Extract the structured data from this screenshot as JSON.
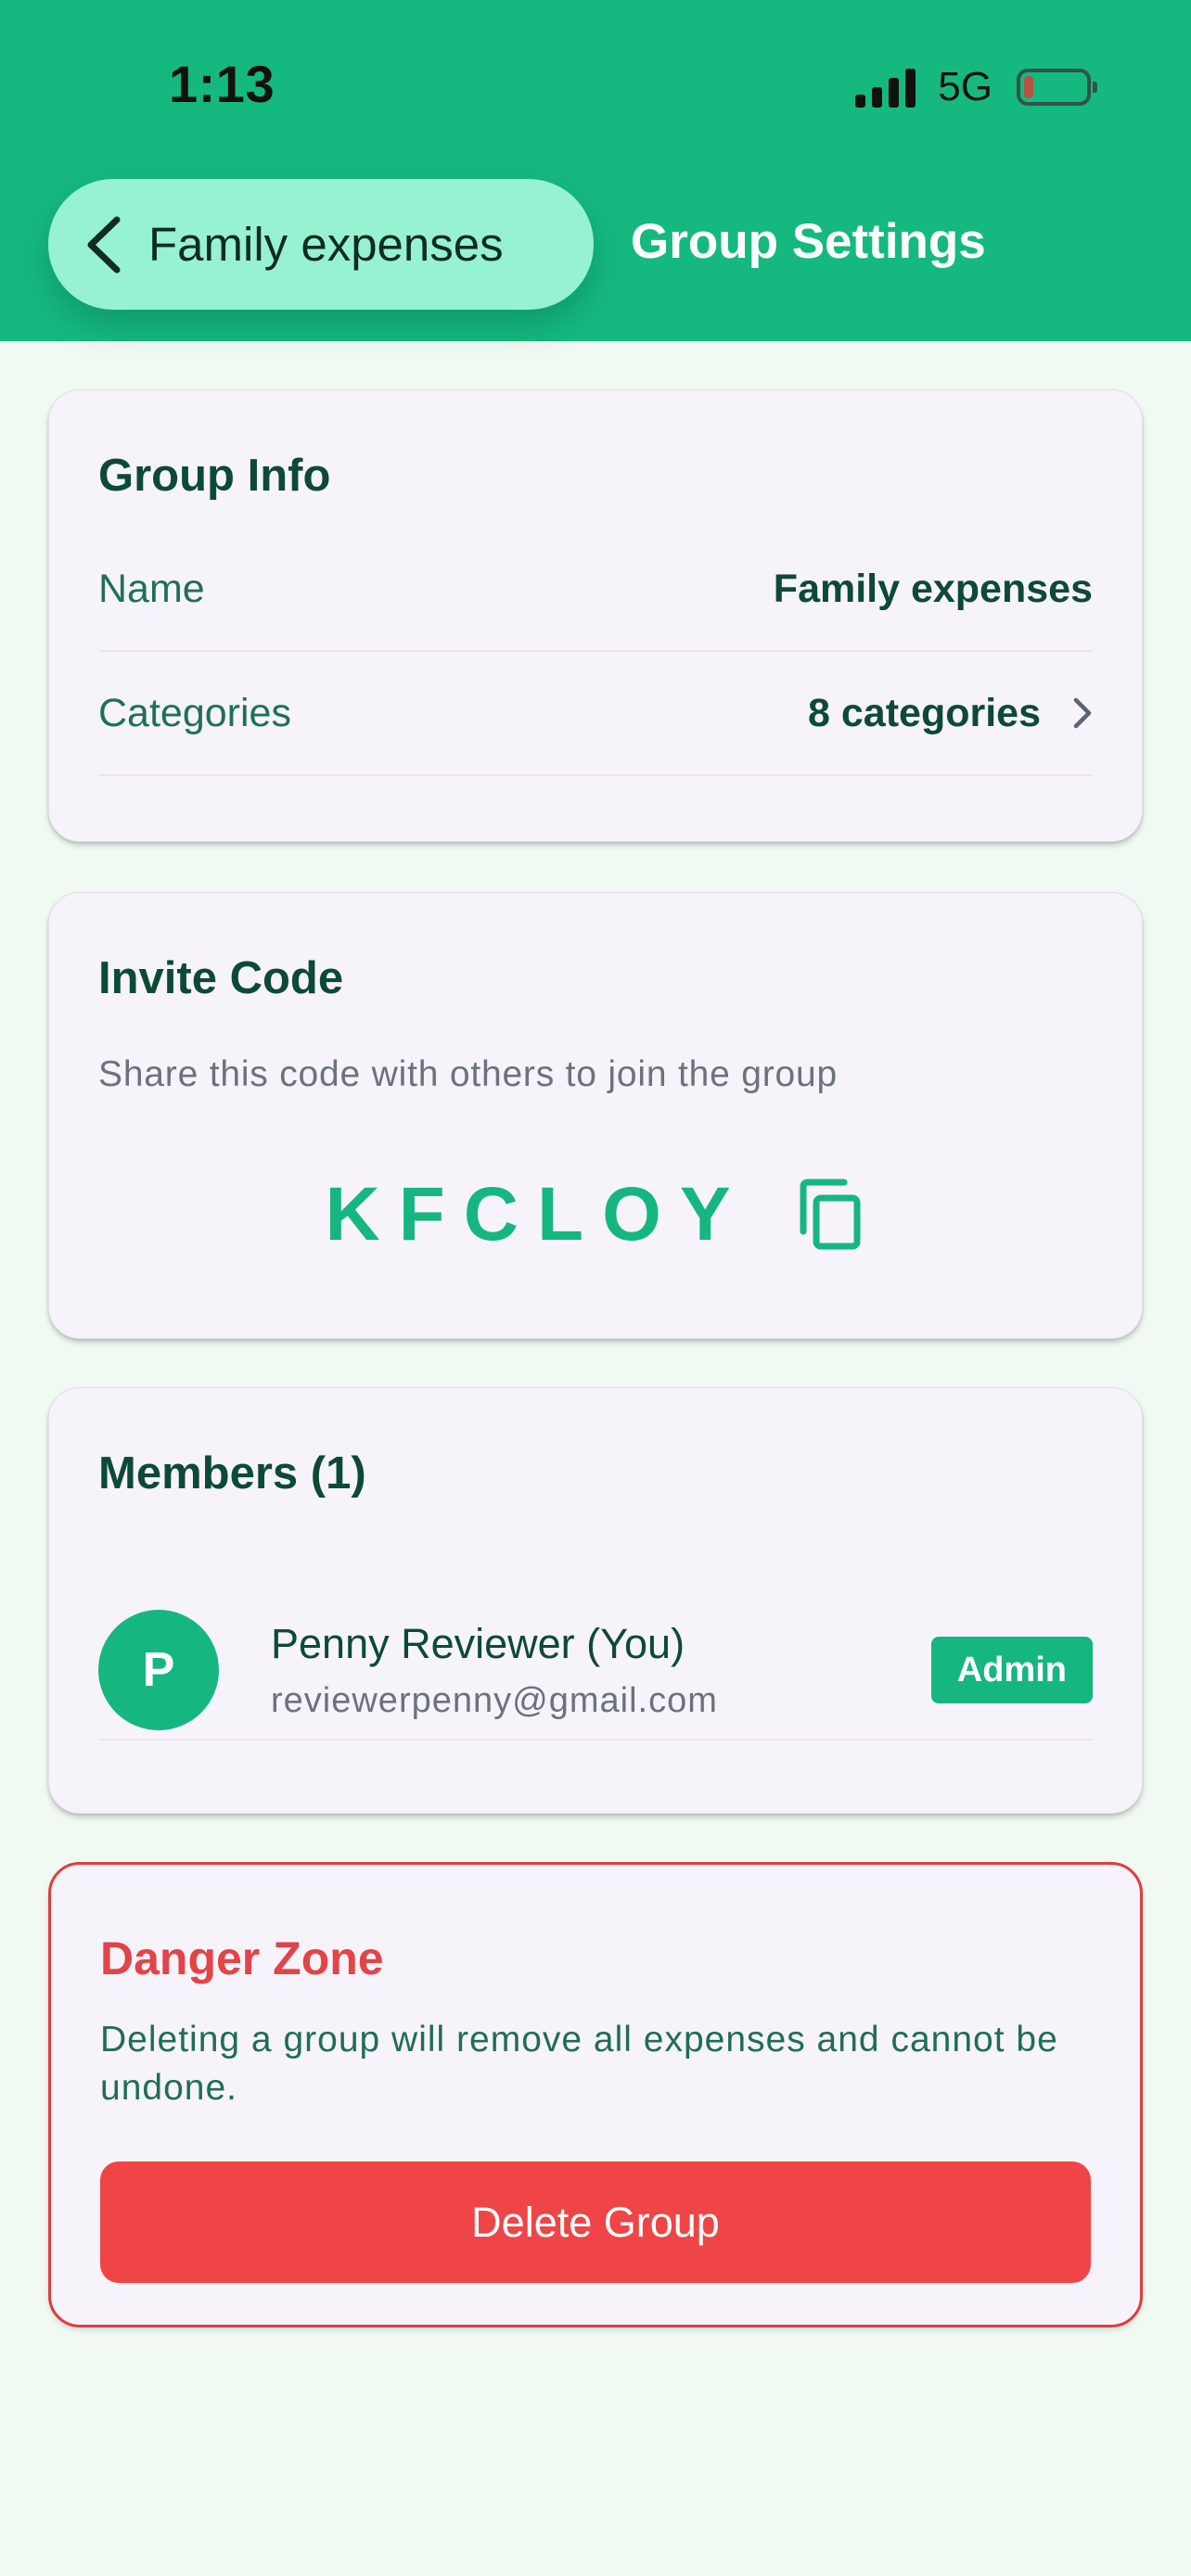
{
  "status_bar": {
    "time": "1:13",
    "network": "5G"
  },
  "header": {
    "back_label": "Family expenses",
    "title": "Group Settings"
  },
  "group_info": {
    "title": "Group Info",
    "name_label": "Name",
    "name_value": "Family expenses",
    "categories_label": "Categories",
    "categories_value": "8 categories"
  },
  "invite": {
    "title": "Invite Code",
    "description": "Share this code with others to join the group",
    "code": "KFCLOY"
  },
  "members": {
    "title": "Members (1)",
    "list": [
      {
        "initial": "P",
        "name": "Penny Reviewer (You)",
        "email": "reviewerpenny@gmail.com",
        "role": "Admin"
      }
    ]
  },
  "danger_zone": {
    "title": "Danger Zone",
    "text": "Deleting a group will remove all expenses and cannot be undone.",
    "delete_label": "Delete Group"
  },
  "colors": {
    "primary": "#15b97f",
    "danger": "#ef4546",
    "background": "#f0faf3",
    "card": "#f7f3fa"
  }
}
